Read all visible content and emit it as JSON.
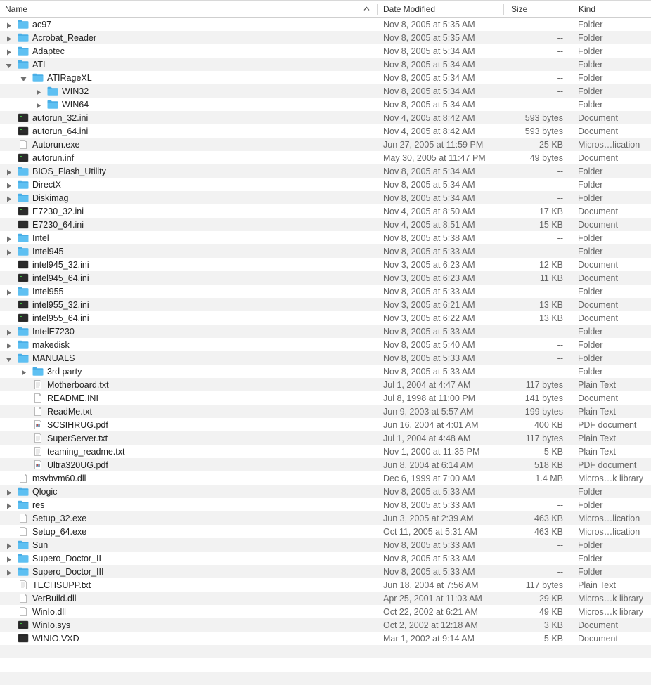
{
  "columns": {
    "name": "Name",
    "date": "Date Modified",
    "size": "Size",
    "kind": "Kind"
  },
  "rows": [
    {
      "name": "ac97",
      "date": "Nov 8, 2005 at 5:35 AM",
      "size": "--",
      "kind": "Folder",
      "depth": 0,
      "icon": "folder-icon",
      "disclosure": "collapsed"
    },
    {
      "name": "Acrobat_Reader",
      "date": "Nov 8, 2005 at 5:35 AM",
      "size": "--",
      "kind": "Folder",
      "depth": 0,
      "icon": "folder-icon",
      "disclosure": "collapsed"
    },
    {
      "name": "Adaptec",
      "date": "Nov 8, 2005 at 5:34 AM",
      "size": "--",
      "kind": "Folder",
      "depth": 0,
      "icon": "folder-icon",
      "disclosure": "collapsed"
    },
    {
      "name": "ATI",
      "date": "Nov 8, 2005 at 5:34 AM",
      "size": "--",
      "kind": "Folder",
      "depth": 0,
      "icon": "folder-icon",
      "disclosure": "expanded"
    },
    {
      "name": "ATIRageXL",
      "date": "Nov 8, 2005 at 5:34 AM",
      "size": "--",
      "kind": "Folder",
      "depth": 1,
      "icon": "folder-icon",
      "disclosure": "expanded"
    },
    {
      "name": "WIN32",
      "date": "Nov 8, 2005 at 5:34 AM",
      "size": "--",
      "kind": "Folder",
      "depth": 2,
      "icon": "folder-icon",
      "disclosure": "collapsed"
    },
    {
      "name": "WIN64",
      "date": "Nov 8, 2005 at 5:34 AM",
      "size": "--",
      "kind": "Folder",
      "depth": 2,
      "icon": "folder-icon",
      "disclosure": "collapsed"
    },
    {
      "name": "autorun_32.ini",
      "date": "Nov 4, 2005 at 8:42 AM",
      "size": "593 bytes",
      "kind": "Document",
      "depth": 0,
      "icon": "terminal-doc-icon",
      "disclosure": "none"
    },
    {
      "name": "autorun_64.ini",
      "date": "Nov 4, 2005 at 8:42 AM",
      "size": "593 bytes",
      "kind": "Document",
      "depth": 0,
      "icon": "terminal-doc-icon",
      "disclosure": "none"
    },
    {
      "name": "Autorun.exe",
      "date": "Jun 27, 2005 at 11:59 PM",
      "size": "25 KB",
      "kind": "Micros…lication",
      "depth": 0,
      "icon": "blank-doc-icon",
      "disclosure": "none"
    },
    {
      "name": "autorun.inf",
      "date": "May 30, 2005 at 11:47 PM",
      "size": "49 bytes",
      "kind": "Document",
      "depth": 0,
      "icon": "terminal-doc-icon",
      "disclosure": "none"
    },
    {
      "name": "BIOS_Flash_Utility",
      "date": "Nov 8, 2005 at 5:34 AM",
      "size": "--",
      "kind": "Folder",
      "depth": 0,
      "icon": "folder-icon",
      "disclosure": "collapsed"
    },
    {
      "name": "DirectX",
      "date": "Nov 8, 2005 at 5:34 AM",
      "size": "--",
      "kind": "Folder",
      "depth": 0,
      "icon": "folder-icon",
      "disclosure": "collapsed"
    },
    {
      "name": "Diskimag",
      "date": "Nov 8, 2005 at 5:34 AM",
      "size": "--",
      "kind": "Folder",
      "depth": 0,
      "icon": "folder-icon",
      "disclosure": "collapsed"
    },
    {
      "name": "E7230_32.ini",
      "date": "Nov 4, 2005 at 8:50 AM",
      "size": "17 KB",
      "kind": "Document",
      "depth": 0,
      "icon": "terminal-doc-icon",
      "disclosure": "none"
    },
    {
      "name": "E7230_64.ini",
      "date": "Nov 4, 2005 at 8:51 AM",
      "size": "15 KB",
      "kind": "Document",
      "depth": 0,
      "icon": "terminal-doc-icon",
      "disclosure": "none"
    },
    {
      "name": "Intel",
      "date": "Nov 8, 2005 at 5:38 AM",
      "size": "--",
      "kind": "Folder",
      "depth": 0,
      "icon": "folder-icon",
      "disclosure": "collapsed"
    },
    {
      "name": "Intel945",
      "date": "Nov 8, 2005 at 5:33 AM",
      "size": "--",
      "kind": "Folder",
      "depth": 0,
      "icon": "folder-icon",
      "disclosure": "collapsed"
    },
    {
      "name": "intel945_32.ini",
      "date": "Nov 3, 2005 at 6:23 AM",
      "size": "12 KB",
      "kind": "Document",
      "depth": 0,
      "icon": "terminal-doc-icon",
      "disclosure": "none"
    },
    {
      "name": "intel945_64.ini",
      "date": "Nov 3, 2005 at 6:23 AM",
      "size": "11 KB",
      "kind": "Document",
      "depth": 0,
      "icon": "terminal-doc-icon",
      "disclosure": "none"
    },
    {
      "name": "Intel955",
      "date": "Nov 8, 2005 at 5:33 AM",
      "size": "--",
      "kind": "Folder",
      "depth": 0,
      "icon": "folder-icon",
      "disclosure": "collapsed"
    },
    {
      "name": "intel955_32.ini",
      "date": "Nov 3, 2005 at 6:21 AM",
      "size": "13 KB",
      "kind": "Document",
      "depth": 0,
      "icon": "terminal-doc-icon",
      "disclosure": "none"
    },
    {
      "name": "intel955_64.ini",
      "date": "Nov 3, 2005 at 6:22 AM",
      "size": "13 KB",
      "kind": "Document",
      "depth": 0,
      "icon": "terminal-doc-icon",
      "disclosure": "none"
    },
    {
      "name": "IntelE7230",
      "date": "Nov 8, 2005 at 5:33 AM",
      "size": "--",
      "kind": "Folder",
      "depth": 0,
      "icon": "folder-icon",
      "disclosure": "collapsed"
    },
    {
      "name": "makedisk",
      "date": "Nov 8, 2005 at 5:40 AM",
      "size": "--",
      "kind": "Folder",
      "depth": 0,
      "icon": "folder-icon",
      "disclosure": "collapsed"
    },
    {
      "name": "MANUALS",
      "date": "Nov 8, 2005 at 5:33 AM",
      "size": "--",
      "kind": "Folder",
      "depth": 0,
      "icon": "folder-icon",
      "disclosure": "expanded"
    },
    {
      "name": "3rd party",
      "date": "Nov 8, 2005 at 5:33 AM",
      "size": "--",
      "kind": "Folder",
      "depth": 1,
      "icon": "folder-icon",
      "disclosure": "collapsed"
    },
    {
      "name": "Motherboard.txt",
      "date": "Jul 1, 2004 at 4:47 AM",
      "size": "117 bytes",
      "kind": "Plain Text",
      "depth": 1,
      "icon": "text-doc-icon",
      "disclosure": "none"
    },
    {
      "name": "README.INI",
      "date": "Jul 8, 1998 at 11:00 PM",
      "size": "141 bytes",
      "kind": "Document",
      "depth": 1,
      "icon": "blank-doc-icon",
      "disclosure": "none"
    },
    {
      "name": "ReadMe.txt",
      "date": "Jun 9, 2003 at 5:57 AM",
      "size": "199 bytes",
      "kind": "Plain Text",
      "depth": 1,
      "icon": "blank-doc-icon",
      "disclosure": "none"
    },
    {
      "name": "SCSIHRUG.pdf",
      "date": "Jun 16, 2004 at 4:01 AM",
      "size": "400 KB",
      "kind": "PDF document",
      "depth": 1,
      "icon": "pdf-doc-icon",
      "disclosure": "none"
    },
    {
      "name": "SuperServer.txt",
      "date": "Jul 1, 2004 at 4:48 AM",
      "size": "117 bytes",
      "kind": "Plain Text",
      "depth": 1,
      "icon": "text-doc-icon",
      "disclosure": "none"
    },
    {
      "name": "teaming_readme.txt",
      "date": "Nov 1, 2000 at 11:35 PM",
      "size": "5 KB",
      "kind": "Plain Text",
      "depth": 1,
      "icon": "text-doc-icon",
      "disclosure": "none"
    },
    {
      "name": "Ultra320UG.pdf",
      "date": "Jun 8, 2004 at 6:14 AM",
      "size": "518 KB",
      "kind": "PDF document",
      "depth": 1,
      "icon": "pdf-doc-icon",
      "disclosure": "none"
    },
    {
      "name": "msvbvm60.dll",
      "date": "Dec 6, 1999 at 7:00 AM",
      "size": "1.4 MB",
      "kind": "Micros…k library",
      "depth": 0,
      "icon": "blank-doc-icon",
      "disclosure": "none"
    },
    {
      "name": "Qlogic",
      "date": "Nov 8, 2005 at 5:33 AM",
      "size": "--",
      "kind": "Folder",
      "depth": 0,
      "icon": "folder-icon",
      "disclosure": "collapsed"
    },
    {
      "name": "res",
      "date": "Nov 8, 2005 at 5:33 AM",
      "size": "--",
      "kind": "Folder",
      "depth": 0,
      "icon": "folder-icon",
      "disclosure": "collapsed"
    },
    {
      "name": "Setup_32.exe",
      "date": "Jun 3, 2005 at 2:39 AM",
      "size": "463 KB",
      "kind": "Micros…lication",
      "depth": 0,
      "icon": "blank-doc-icon",
      "disclosure": "none"
    },
    {
      "name": "Setup_64.exe",
      "date": "Oct 11, 2005 at 5:31 AM",
      "size": "463 KB",
      "kind": "Micros…lication",
      "depth": 0,
      "icon": "blank-doc-icon",
      "disclosure": "none"
    },
    {
      "name": "Sun",
      "date": "Nov 8, 2005 at 5:33 AM",
      "size": "--",
      "kind": "Folder",
      "depth": 0,
      "icon": "folder-icon",
      "disclosure": "collapsed"
    },
    {
      "name": "Supero_Doctor_II",
      "date": "Nov 8, 2005 at 5:33 AM",
      "size": "--",
      "kind": "Folder",
      "depth": 0,
      "icon": "folder-icon",
      "disclosure": "collapsed"
    },
    {
      "name": "Supero_Doctor_III",
      "date": "Nov 8, 2005 at 5:33 AM",
      "size": "--",
      "kind": "Folder",
      "depth": 0,
      "icon": "folder-icon",
      "disclosure": "collapsed"
    },
    {
      "name": "TECHSUPP.txt",
      "date": "Jun 18, 2004 at 7:56 AM",
      "size": "117 bytes",
      "kind": "Plain Text",
      "depth": 0,
      "icon": "text-doc-icon",
      "disclosure": "none"
    },
    {
      "name": "VerBuild.dll",
      "date": "Apr 25, 2001 at 11:03 AM",
      "size": "29 KB",
      "kind": "Micros…k library",
      "depth": 0,
      "icon": "blank-doc-icon",
      "disclosure": "none"
    },
    {
      "name": "WinIo.dll",
      "date": "Oct 22, 2002 at 6:21 AM",
      "size": "49 KB",
      "kind": "Micros…k library",
      "depth": 0,
      "icon": "blank-doc-icon",
      "disclosure": "none"
    },
    {
      "name": "WinIo.sys",
      "date": "Oct 2, 2002 at 12:18 AM",
      "size": "3 KB",
      "kind": "Document",
      "depth": 0,
      "icon": "terminal-doc-icon",
      "disclosure": "none"
    },
    {
      "name": "WINIO.VXD",
      "date": "Mar 1, 2002 at 9:14 AM",
      "size": "5 KB",
      "kind": "Document",
      "depth": 0,
      "icon": "terminal-doc-icon",
      "disclosure": "none"
    }
  ],
  "colors": {
    "folder": "#5ec0f2",
    "folder_tab": "#49aee6",
    "stripe": "#f2f2f2",
    "secondary_text": "#666666"
  }
}
